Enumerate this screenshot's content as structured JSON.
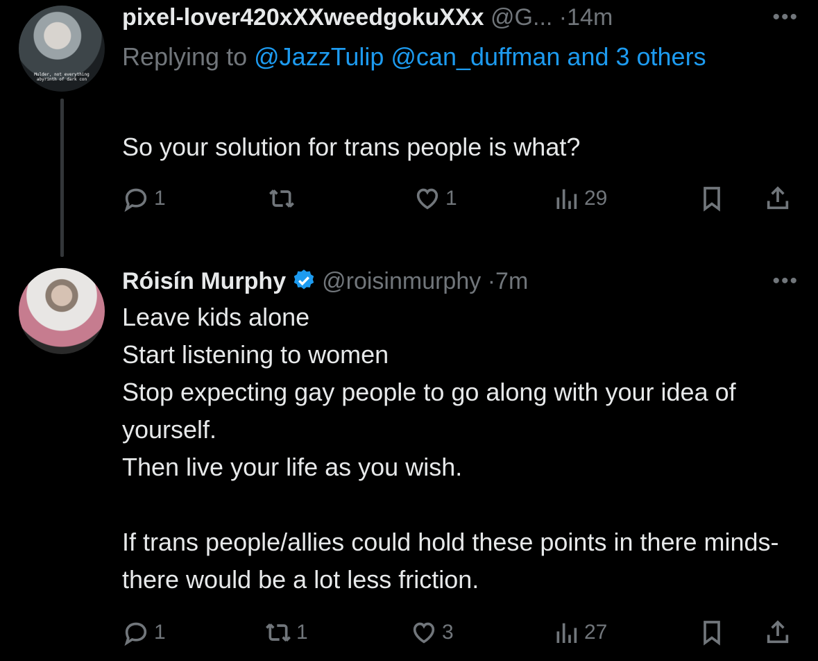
{
  "tweets": [
    {
      "author_name": "pixel-lover420xXXweedgokuXXx",
      "handle": "@G...",
      "dot": "·",
      "time": "14m",
      "avatar_caption": "Mulder, not everything abyrinth of dark con",
      "replying_prefix": "Replying to",
      "replying_mentions": "@JazzTulip @can_duffman and 3 others",
      "text": "So your solution for trans people is what?",
      "replies": "1",
      "retweets": "",
      "likes": "1",
      "views": "29"
    },
    {
      "author_name": "Róisín Murphy",
      "handle": "@roisinmurphy",
      "dot": "·",
      "time": "7m",
      "text": "Leave kids alone\nStart listening to women\nStop expecting gay people to go along with your idea of yourself.\nThen live your life as you wish.\n\nIf trans people/allies could hold these points in there minds- there would be a lot less friction.",
      "replies": "1",
      "retweets": "1",
      "likes": "3",
      "views": "27"
    }
  ],
  "icons": {
    "more": "more-icon",
    "reply": "reply-icon",
    "retweet": "retweet-icon",
    "like": "heart-icon",
    "views": "views-icon",
    "bookmark": "bookmark-icon",
    "share": "share-icon",
    "verified": "verified-badge-icon"
  },
  "colors": {
    "accent": "#1d9bf0",
    "muted": "#71767b",
    "text": "#e7e9ea",
    "background": "#000000"
  }
}
